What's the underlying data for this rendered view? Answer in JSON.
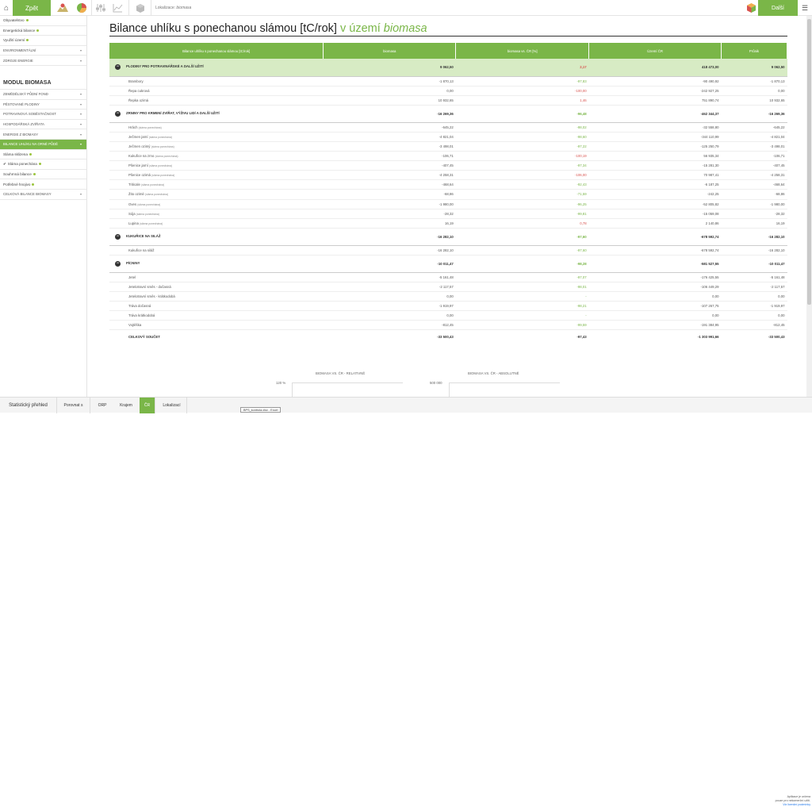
{
  "topbar": {
    "back_label": "Zpět",
    "location_prefix": "Lokalizace:",
    "location_value": "biomasa",
    "next_label": "Další"
  },
  "sidebar": {
    "items_top": [
      {
        "label": "Obyvatelstvo",
        "dot": true
      },
      {
        "label": "Energetická bilance",
        "dot": true
      },
      {
        "label": "Využití území",
        "dot": true
      },
      {
        "label": "Environmentální",
        "cat": true
      },
      {
        "label": "Zdroje energie",
        "cat": true
      }
    ],
    "module_title": "MODUL BIOMASA",
    "items_module": [
      {
        "label": "Zemědělský půdní fond",
        "cat": true
      },
      {
        "label": "Pěstované plodiny",
        "cat": true
      },
      {
        "label": "Potravinová soběstačnost",
        "cat": true
      },
      {
        "label": "Hospodářská zvířata",
        "cat": true
      },
      {
        "label": "Energie z biomasy",
        "cat": true
      },
      {
        "label": "Bilance uhlíku na orné půdě",
        "cat": true,
        "active": true
      },
      {
        "label": "Sláma sklizena",
        "dot": true
      },
      {
        "label": "Sláma ponechána",
        "dot": true,
        "checked": true
      },
      {
        "label": "Souhrnná bilance",
        "dot": true
      },
      {
        "label": "Potřebné hnojivo",
        "dot": true
      },
      {
        "label": "Celková bilance biomasy",
        "cat": true
      }
    ]
  },
  "main": {
    "title": "Bilance uhlíku s ponechanou slámou [tC/rok]",
    "title_suffix": "v území",
    "title_suffix_italic": "biomasa",
    "table": {
      "headers": [
        "Bilance uhlíku s ponechanou slámou [tC/rok]",
        "biomasa",
        "biomasa vs. ČR [%]",
        "Území ČR",
        "Průnik"
      ],
      "groups": [
        {
          "label": "PLODINY PRO POTRAVINÁŘSKÉ A DALŠÍ UŽITÍ",
          "values": [
            "9 062,50",
            "2,17",
            "418 473,00",
            "9 062,50"
          ],
          "pct_color": "red",
          "highlight": true,
          "rows": [
            {
              "label": "Brambory",
              "values": [
                "-1 870,13",
                "-97,83",
                "-90 490,92",
                "-1 870,13"
              ],
              "pct_color": "g"
            },
            {
              "label": "Řepa cukrová",
              "values": [
                "0,00",
                "-100,00",
                "-242 927,25",
                "0,00"
              ],
              "pct_color": "r"
            },
            {
              "label": "Řepka ozimá",
              "values": [
                "10 932,65",
                "1,46",
                "751 890,74",
                "10 932,65"
              ],
              "pct_color": "r"
            }
          ]
        },
        {
          "label": "ZRNINY PRO KRMENÍ ZVÍŘAT, VÝŽIVU LIDÍ A DALŠÍ UŽITÍ",
          "values": [
            "-16 269,36",
            "-96,48",
            "-462 344,37",
            "-16 269,36"
          ],
          "pct_color": "green",
          "rows": [
            {
              "label": "Hrách",
              "note": "(sláma ponechána)",
              "values": [
                "-645,22",
                "-98,02",
                "-32 558,80",
                "-645,22"
              ],
              "pct_color": "g"
            },
            {
              "label": "Ječmen jarní",
              "note": "(sláma ponechána)",
              "values": [
                "-4 821,04",
                "-98,60",
                "-344 110,99",
                "-4 821,04"
              ],
              "pct_color": "g"
            },
            {
              "label": "Ječmen ozimý",
              "note": "(sláma ponechána)",
              "values": [
                "-3 498,01",
                "-97,22",
                "-125 250,79",
                "-3 498,01"
              ],
              "pct_color": "g"
            },
            {
              "label": "Kukuřice na zrno",
              "note": "(sláma ponechána)",
              "values": [
                "-106,71",
                "-100,19",
                "56 935,34",
                "-106,71"
              ],
              "pct_color": "r"
            },
            {
              "label": "Pšenice jarní",
              "note": "(sláma ponechána)",
              "values": [
                "-407,45",
                "-97,34",
                "-15 281,30",
                "-407,45"
              ],
              "pct_color": "g"
            },
            {
              "label": "Pšenice ozimá",
              "note": "(sláma ponechána)",
              "values": [
                "-4 258,31",
                "-106,00",
                "70 987,41",
                "-4 258,31"
              ],
              "pct_color": "r"
            },
            {
              "label": "Triticale",
              "note": "(sláma ponechána)",
              "values": [
                "-468,64",
                "-92,43",
                "-6 187,25",
                "-468,64"
              ],
              "pct_color": "g"
            },
            {
              "label": "Žito ozimé",
              "note": "(sláma ponechána)",
              "values": [
                "-68,86",
                "-71,59",
                "-242,25",
                "-68,86"
              ],
              "pct_color": "g"
            },
            {
              "label": "Oves",
              "note": "(sláma ponechána)",
              "values": [
                "-1 980,00",
                "-96,25",
                "-52 805,82",
                "-1 980,00"
              ],
              "pct_color": "g"
            },
            {
              "label": "Sója",
              "note": "(sláma ponechána)",
              "values": [
                "-28,32",
                "-99,81",
                "-15 059,08",
                "-28,32"
              ],
              "pct_color": "g"
            },
            {
              "label": "Lupina",
              "note": "(sláma ponechána)",
              "values": [
                "16,19",
                "0,78",
                "2 140,86",
                "16,19"
              ],
              "pct_color": "r"
            }
          ]
        },
        {
          "label": "KUKUŘICE NA SILÁŽ",
          "values": [
            "-16 282,10",
            "-97,60",
            "-678 592,74",
            "-16 282,10"
          ],
          "pct_color": "green",
          "rows": [
            {
              "label": "Kukuřice na siláž",
              "values": [
                "-16 282,10",
                "-97,60",
                "-678 592,74",
                "-16 282,10"
              ],
              "pct_color": "g"
            }
          ]
        },
        {
          "label": "PÍCNINY",
          "values": [
            "-10 011,47",
            "-98,28",
            "-581 527,55",
            "-10 011,47"
          ],
          "pct_color": "green",
          "rows": [
            {
              "label": "Jetel",
              "values": [
                "-5 161,48",
                "-97,07",
                "-176 425,55",
                "-5 161,48"
              ],
              "pct_color": "g"
            },
            {
              "label": "Jetelotravní směs - dočasná",
              "values": [
                "-2 117,57",
                "-98,01",
                "-106 449,29",
                "-2 117,57"
              ],
              "pct_color": "g"
            },
            {
              "label": "Jetelotravní směs - krátkodobá",
              "values": [
                "0,00",
                "-",
                "0,00",
                "0,00"
              ],
              "pct_color": "g"
            },
            {
              "label": "Tráva dočasná",
              "values": [
                "-1 919,97",
                "-98,21",
                "-107 267,75",
                "-1 919,97"
              ],
              "pct_color": "g"
            },
            {
              "label": "Tráva krátkodobá",
              "values": [
                "0,00",
                "-",
                "0,00",
                "0,00"
              ],
              "pct_color": "g"
            },
            {
              "label": "Vojtěška",
              "values": [
                "-812,45",
                "-99,59",
                "-191 384,95",
                "-812,45"
              ],
              "pct_color": "g"
            }
          ]
        }
      ],
      "total": {
        "label": "CELKOVÝ SOUČET",
        "values": [
          "-33 500,43",
          "-97,43",
          "-1 303 991,66",
          "-33 500,43"
        ]
      }
    }
  },
  "charts": {
    "left_title": "BIOMASA  VS.  ČR  - RELATIVNĚ",
    "left_tick": "120 %",
    "right_title": "BIOMASA  VS.  ČR  - ABSOLUTNĚ",
    "right_tick": "500 000"
  },
  "bottombar": {
    "stat_label": "Statistický přehled",
    "compare_label": "Porovnat s",
    "orp": "ORP",
    "kraj": "Krajem",
    "cr": "ČR",
    "lok": "Lokalizací",
    "excel": "BPS_kontrola.xlsx - Excel",
    "note_line1": "Aplikace je určena",
    "note_line2": "pouze pro nekomerční užití.",
    "note_link": "Viz licenční podmínky"
  }
}
